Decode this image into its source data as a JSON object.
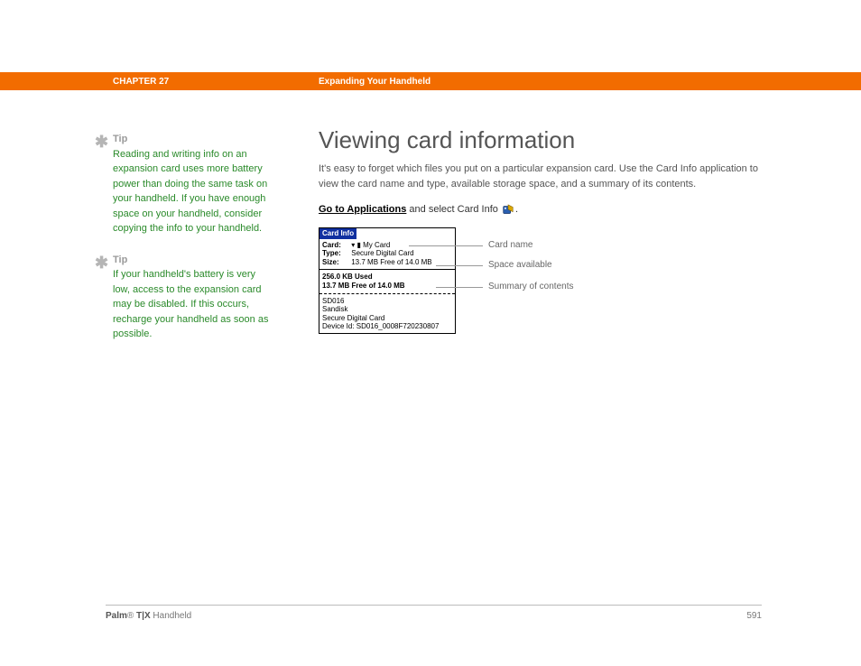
{
  "header": {
    "chapter": "CHAPTER 27",
    "section": "Expanding Your Handheld"
  },
  "sidebar": {
    "tips": [
      {
        "label": "Tip",
        "body": "Reading and writing info on an expansion card uses more battery power than doing the same task on your handheld. If you have enough space on your handheld, consider copying the info to your handheld."
      },
      {
        "label": "Tip",
        "body": "If your handheld's battery is very low, access to the expansion card may be disabled. If this occurs, recharge your handheld as soon as possible."
      }
    ]
  },
  "main": {
    "title": "Viewing card information",
    "intro": "It's easy to forget which files you put on a particular expansion card. Use the Card Info application to view the card name and type, available storage space, and a summary of its contents.",
    "action_link": "Go to Applications",
    "action_rest": " and select Card Info ",
    "action_period": "."
  },
  "screenshot": {
    "title": "Card Info",
    "card_label": "Card:",
    "card_value": "My Card",
    "type_label": "Type:",
    "type_value": "Secure Digital Card",
    "size_label": "Size:",
    "size_value": "13.7 MB Free of 14.0 MB",
    "used_line": "256.0 KB Used",
    "free_line": "13.7 MB Free of 14.0 MB",
    "detail_lines": [
      "SD016",
      "Sandisk",
      "Secure Digital Card",
      "Device Id: SD016_0008F720230807"
    ]
  },
  "callouts": {
    "card_name": "Card name",
    "space_available": "Space available",
    "summary": "Summary of contents"
  },
  "footer": {
    "product_bold": "Palm",
    "product_reg": "®",
    "product_model": " T|X",
    "product_type": " Handheld",
    "page_number": "591"
  }
}
